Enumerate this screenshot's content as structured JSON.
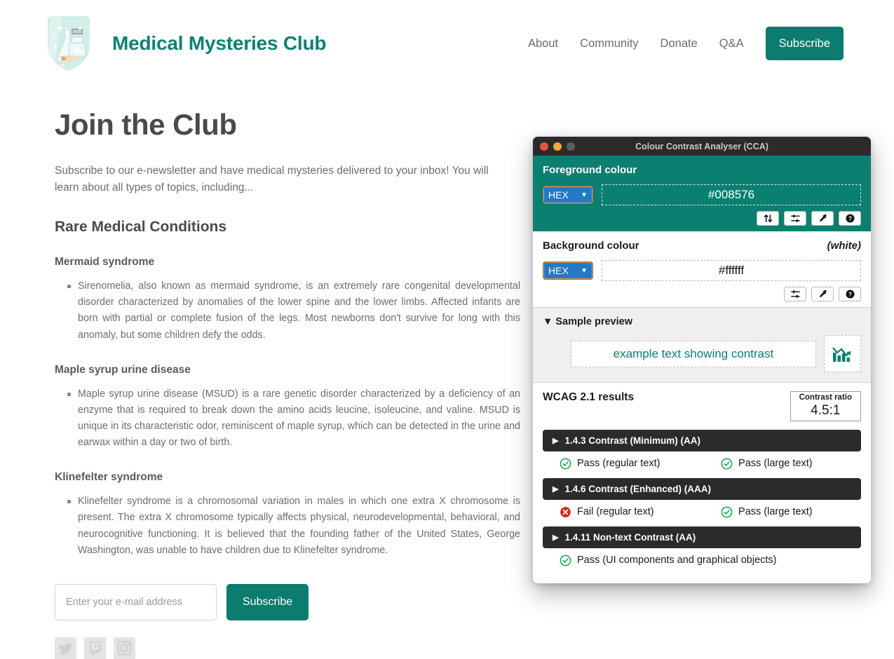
{
  "site": {
    "brand_name": "Medical Mysteries Club",
    "logo_icon": "medical-shield-logo",
    "nav": [
      {
        "label": "About",
        "icon": ""
      },
      {
        "label": "Community",
        "icon": ""
      },
      {
        "label": "Donate",
        "icon": ""
      },
      {
        "label": "Q&A",
        "icon": ""
      }
    ],
    "cta_label": "Subscribe",
    "accent_color": "#0b7c6e",
    "brand_color": "#0d8174"
  },
  "main": {
    "page_title": "Join the Club",
    "intro": "Subscribe to our e-newsletter and have medical mysteries delivered to your inbox! You will learn about all types of topics, including...",
    "section_heading": "Rare Medical Conditions",
    "conditions": [
      {
        "heading": "Mermaid syndrome",
        "body": "Sirenomelia, also known as mermaid syndrome, is an extremely rare congenital developmental disorder characterized by anomalies of the lower spine and the lower limbs. Affected infants are born with partial or complete fusion of the legs. Most newborns don't survive for long with this anomaly, but some children defy the odds."
      },
      {
        "heading": "Maple syrup urine disease",
        "body": "Maple syrup urine disease (MSUD) is a rare genetic disorder characterized by a deficiency of an enzyme that is required to break down the amino acids leucine, isoleucine, and valine. MSUD is unique in its characteristic odor, reminiscent of maple syrup, which can be detected in the urine and earwax within a day or two of birth."
      },
      {
        "heading": "Klinefelter syndrome",
        "body": "Klinefelter syndrome is a chromosomal variation in males in which one extra X chromosome is present. The extra X chromosome typically affects physical, neurodevelopmental, behavioral, and neurocognitive functioning. It is believed that the founding father of the United States, George Washington, was unable to have children due to Klinefelter syndrome."
      }
    ],
    "signup": {
      "email_placeholder": "Enter your e-mail address",
      "email_value": "",
      "submit_label": "Subscribe"
    },
    "socials": [
      {
        "name": "twitter-icon",
        "label": "Twitter"
      },
      {
        "name": "twitch-icon",
        "label": "Twitch"
      },
      {
        "name": "instagram-icon",
        "label": "Instagram"
      }
    ]
  },
  "cca": {
    "window_title": "Colour Contrast Analyser (CCA)",
    "traffic_lights": [
      "close",
      "minimize",
      "zoom"
    ],
    "foreground": {
      "label": "Foreground colour",
      "format": "HEX",
      "value": "#008576",
      "note": "",
      "buttons": [
        {
          "name": "swap-colours-icon",
          "label": "Swap colours"
        },
        {
          "name": "sliders-icon",
          "label": "Colour sliders"
        },
        {
          "name": "eyedropper-icon",
          "label": "Pick colour"
        },
        {
          "name": "help-icon",
          "label": "Help"
        }
      ]
    },
    "background": {
      "label": "Background colour",
      "format": "HEX",
      "value": "#ffffff",
      "note": "(white)",
      "buttons": [
        {
          "name": "sliders-icon",
          "label": "Colour sliders"
        },
        {
          "name": "eyedropper-icon",
          "label": "Pick colour"
        },
        {
          "name": "help-icon",
          "label": "Help"
        }
      ]
    },
    "preview": {
      "disclosure_label": "Sample preview",
      "disclosure_state": "expanded",
      "sample_text": "example text showing contrast",
      "sample_graphic_icon": "bar-chart-declining-icon",
      "sample_colour": "#0b7f70"
    },
    "results": {
      "title": "WCAG 2.1 results",
      "ratio_label": "Contrast ratio",
      "ratio_value": "4.5:1",
      "criteria": [
        {
          "title": "1.4.3 Contrast (Minimum) (AA)",
          "results": [
            {
              "status": "pass",
              "label": "Pass (regular text)"
            },
            {
              "status": "pass",
              "label": "Pass (large text)"
            }
          ]
        },
        {
          "title": "1.4.6 Contrast (Enhanced) (AAA)",
          "results": [
            {
              "status": "fail",
              "label": "Fail (regular text)"
            },
            {
              "status": "pass",
              "label": "Pass (large text)"
            }
          ]
        },
        {
          "title": "1.4.11 Non-text Contrast (AA)",
          "results": [
            {
              "status": "pass",
              "label": "Pass (UI components and graphical objects)"
            }
          ]
        }
      ]
    }
  }
}
